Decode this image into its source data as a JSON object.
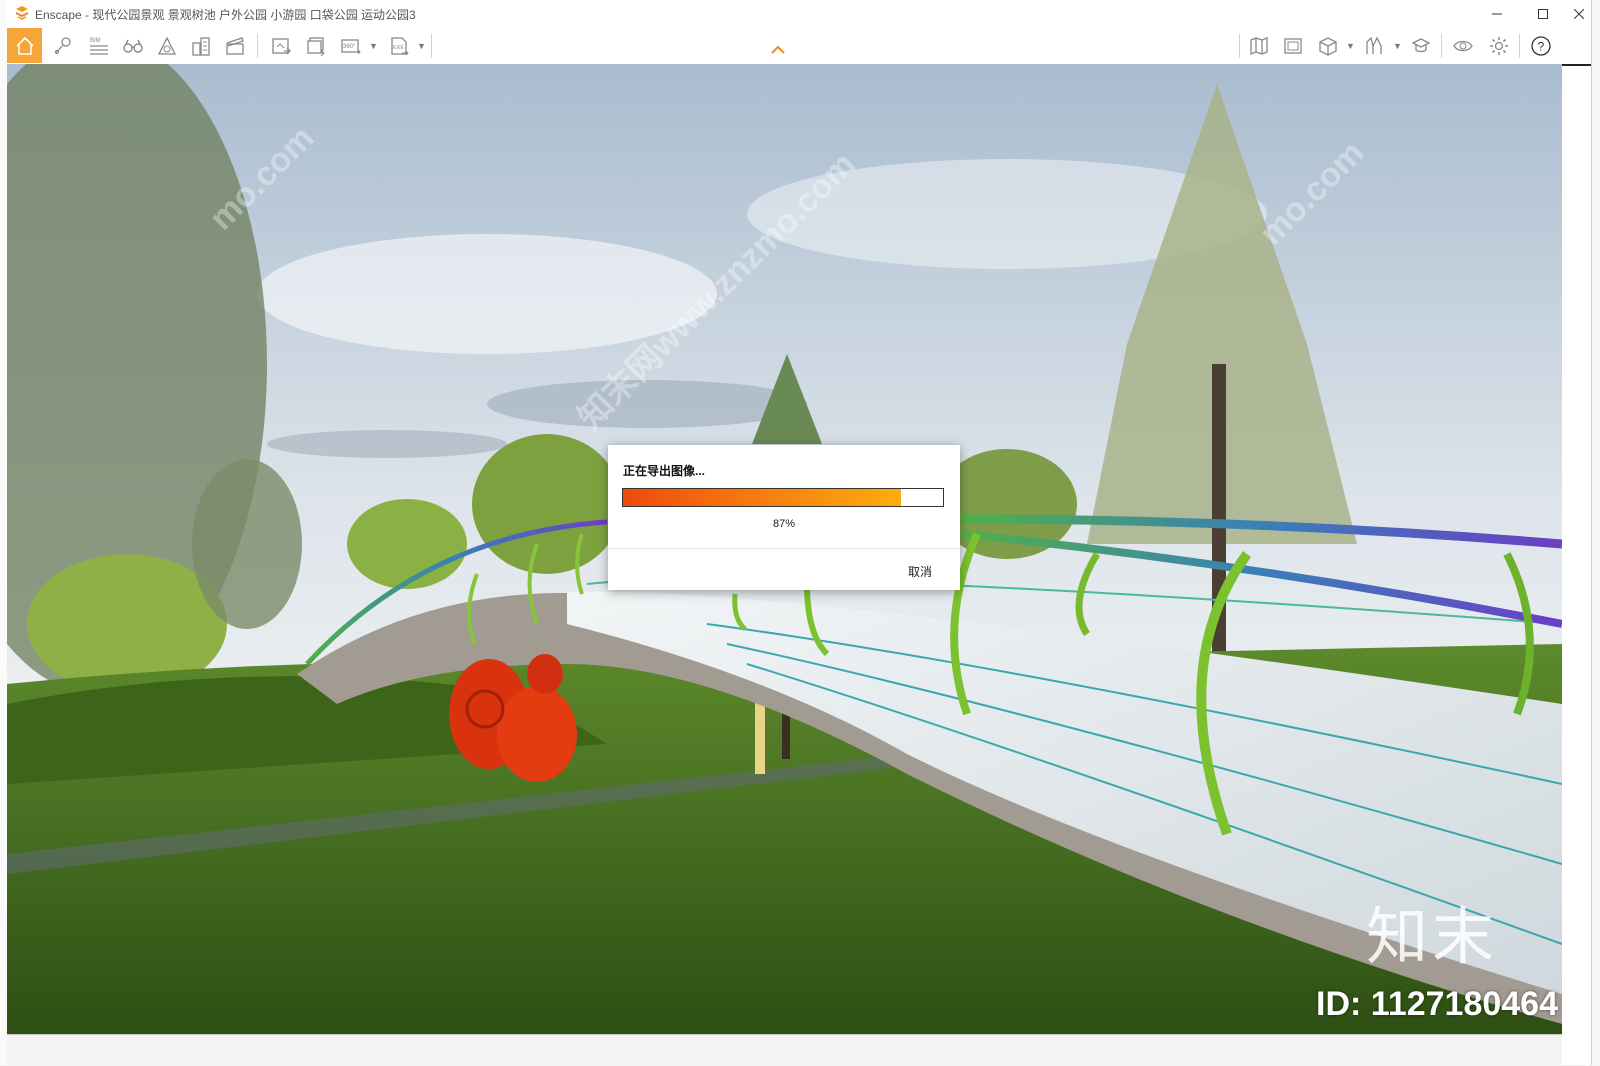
{
  "window": {
    "title": "Enscape - 现代公园景观 景观树池 户外公园 小游园 口袋公园 运动公园3",
    "minimize_icon": "minimize-icon",
    "maximize_icon": "maximize-icon",
    "close_icon": "close-icon"
  },
  "toolbar": {
    "left_icons": [
      "home-icon",
      "pin-icon",
      "bim-icon",
      "binoculars-icon",
      "sun-icon",
      "buildings-icon",
      "clapperboard-icon",
      "screenshot-icon",
      "batch-render-icon",
      "panorama-360-icon",
      "exe-export-icon"
    ],
    "right_icons": [
      "map-icon",
      "asset-library-icon",
      "view-cube-icon",
      "material-icon",
      "feedback-icon",
      "visibility-icon",
      "settings-icon",
      "help-icon"
    ],
    "bim_label": "BIM",
    "pano_label": "360°",
    "exe_label": "EXE",
    "accent_color": "#f6a53a"
  },
  "dialog": {
    "title": "正在导出图像...",
    "progress_percent": 87,
    "progress_text": "87%",
    "cancel_label": "取消"
  },
  "watermark": {
    "url": "知末网www.znzmo.com",
    "url_short": "mo.com",
    "brand": "知末",
    "id": "ID: 1127180464"
  }
}
